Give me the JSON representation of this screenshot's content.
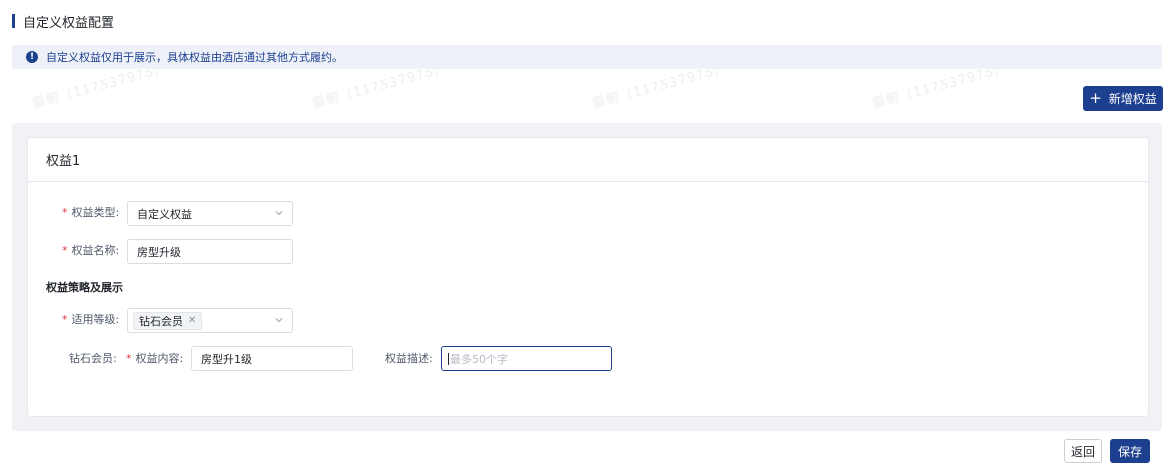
{
  "page": {
    "title": "自定义权益配置"
  },
  "notice": {
    "icon": "info-icon",
    "text": "自定义权益仅用于展示，具体权益由酒店通过其他方式履约。"
  },
  "toolbar": {
    "add_icon": "plus-icon",
    "add_label": "新增权益"
  },
  "benefit_card": {
    "title": "权益1",
    "type_field": {
      "label": "权益类型:",
      "value": "自定义权益"
    },
    "name_field": {
      "label": "权益名称:",
      "value": "房型升级"
    },
    "strategy_section": {
      "title": "权益策略及展示"
    },
    "level_field": {
      "label": "适用等级:",
      "tags": [
        "钻石会员"
      ]
    },
    "tier_row": {
      "tier_label": "钻石会员:",
      "content_label": "权益内容:",
      "content_value": "房型升1级",
      "desc_label": "权益描述:",
      "desc_placeholder": "最多50个字"
    }
  },
  "footer": {
    "back_label": "返回",
    "save_label": "保存"
  },
  "watermark": {
    "text": "雷鹏（11753797​5）"
  },
  "colors": {
    "primary": "#1d3f8f",
    "required": "#d9363e",
    "notice_bg": "#eef2f8",
    "panel_bg": "#f1f2f5"
  }
}
